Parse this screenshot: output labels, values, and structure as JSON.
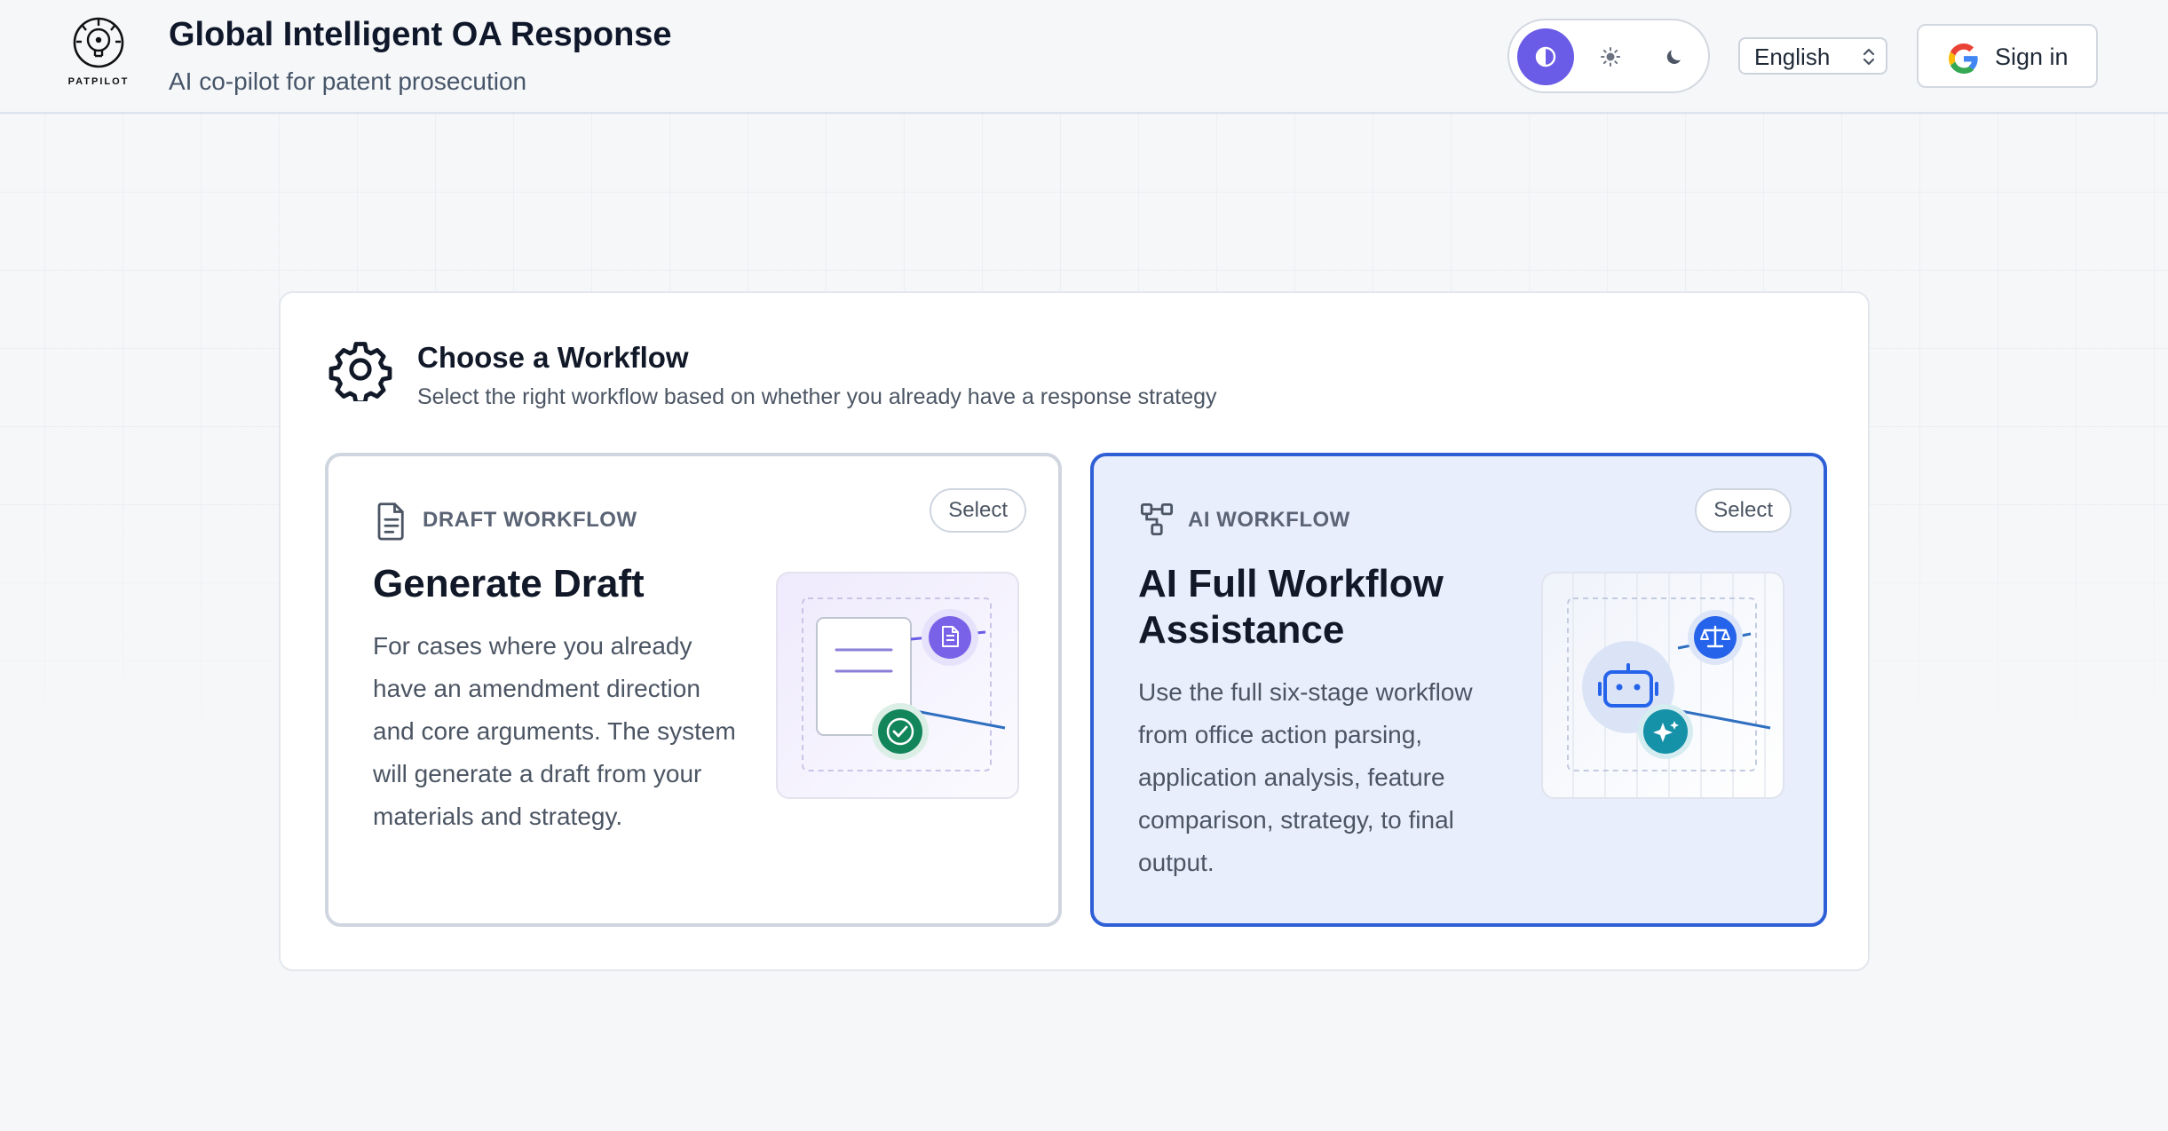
{
  "brand": {
    "logo_text": "PATPILOT",
    "title": "Global Intelligent OA Response",
    "subtitle": "AI co-pilot for patent prosecution"
  },
  "header": {
    "theme_options": [
      {
        "name": "auto",
        "icon": "contrast-icon",
        "active": true
      },
      {
        "name": "light",
        "icon": "sun-icon",
        "active": false
      },
      {
        "name": "dark",
        "icon": "moon-icon",
        "active": false
      }
    ],
    "language": {
      "selected": "English"
    },
    "sign_in_label": "Sign in"
  },
  "workflow": {
    "title": "Choose a Workflow",
    "subtitle": "Select the right workflow based on whether you already have a response strategy",
    "cards": [
      {
        "kicker": "DRAFT WORKFLOW",
        "select_label": "Select",
        "title": "Generate Draft",
        "description": "For cases where you already have an amendment direction and core arguments. The system will generate a draft from your materials and strategy.",
        "icon": "document-icon",
        "selected": false
      },
      {
        "kicker": "AI WORKFLOW",
        "select_label": "Select",
        "title": "AI Full Workflow Assistance",
        "description": "Use the full six-stage workflow from office action parsing, application analysis, feature comparison, strategy, to final output.",
        "icon": "workflow-icon",
        "selected": true
      }
    ]
  },
  "colors": {
    "accent": "#6b5ce7",
    "selected_border": "#2f5fd6",
    "selected_bg": "#e9eefc",
    "success": "#12855b",
    "teal": "#1591a8"
  }
}
